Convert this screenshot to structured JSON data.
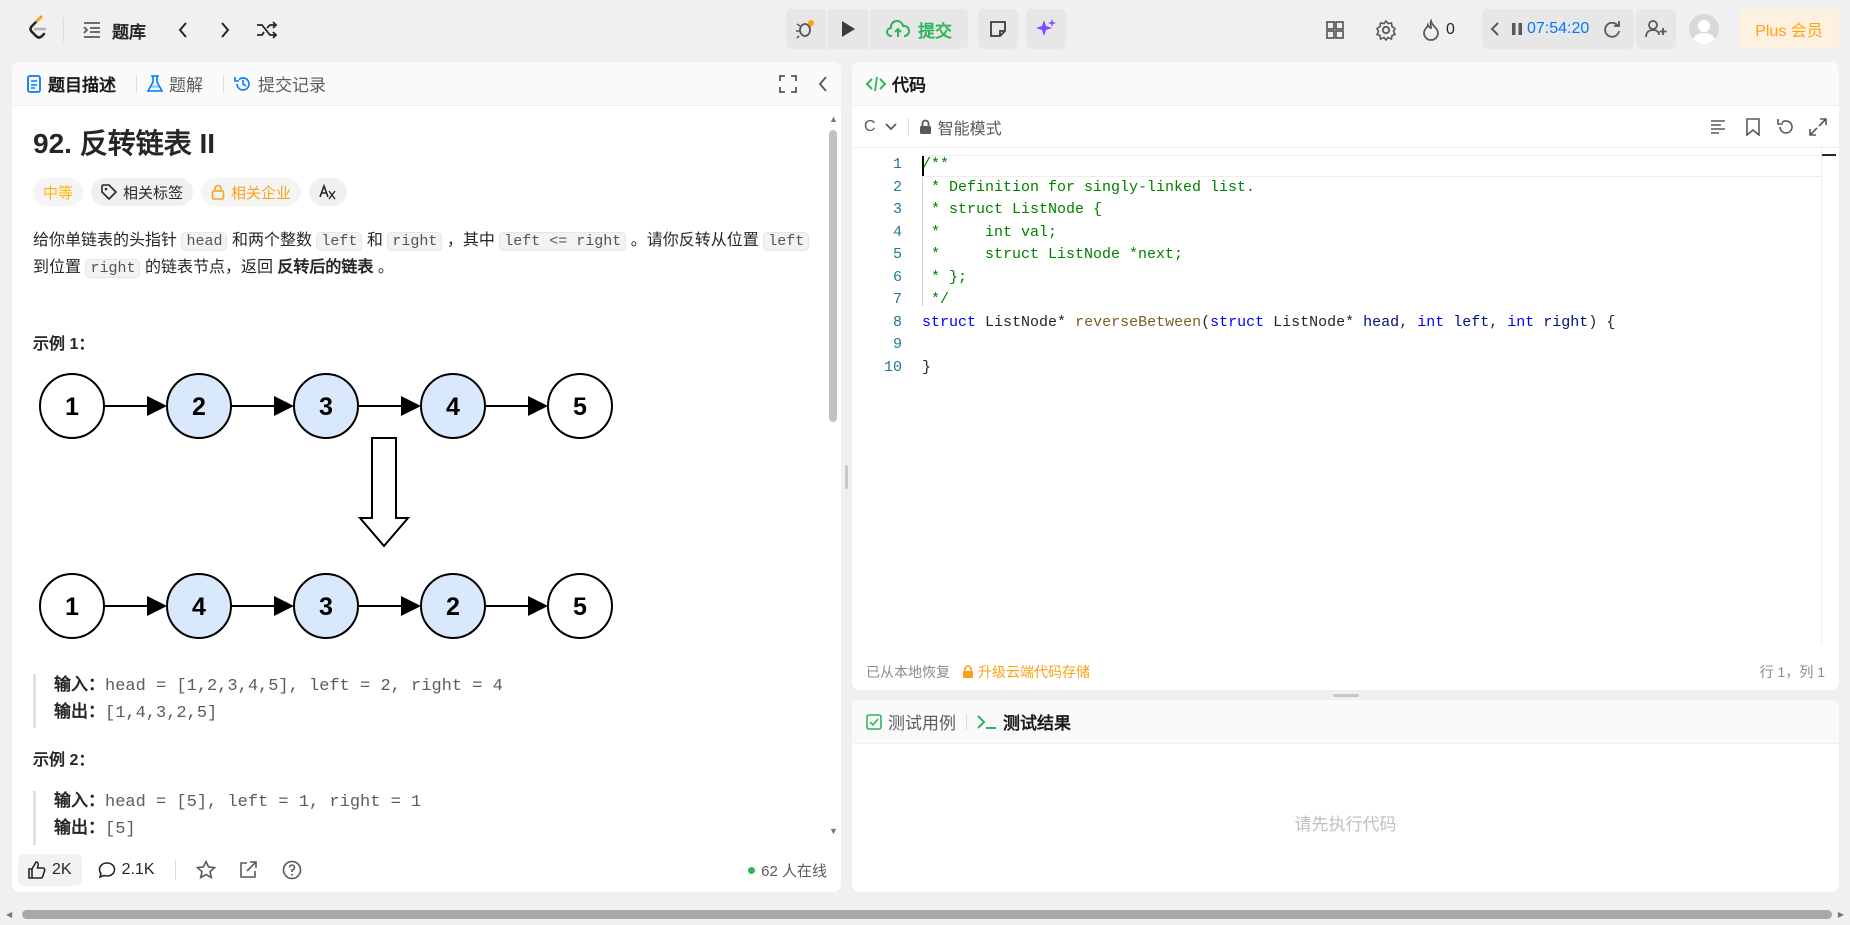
{
  "topbar": {
    "problem_list_label": "题库",
    "submit_label": "提交",
    "streak_count": "0",
    "timer": "07:54:20",
    "plus_label": "Plus 会员"
  },
  "left": {
    "tabs": [
      {
        "label": "题目描述"
      },
      {
        "label": "题解"
      },
      {
        "label": "提交记录"
      }
    ],
    "title": "92. 反转链表 II",
    "difficulty": "中等",
    "tag_related": "相关标签",
    "tag_company": "相关企业",
    "desc": {
      "p1": "给你单链表的头指针",
      "c1": "head",
      "p2": "和两个整数",
      "c2": "left",
      "p3": "和",
      "c3": "right",
      "p4": "，其中",
      "c4": "left <= right",
      "p5": "。请你反转从位置",
      "c5": "left",
      "p6": "到位置",
      "c6": "right",
      "p7": "的链表节点，返回",
      "b1": "反转后的链表",
      "p8": "。"
    },
    "example1": {
      "heading": "示例 1：",
      "input_label": "输入：",
      "input": "head = [1,2,3,4,5], left = 2, right = 4",
      "output_label": "输出：",
      "output": "[1,4,3,2,5]"
    },
    "diagram": {
      "top": [
        "1",
        "2",
        "3",
        "4",
        "5"
      ],
      "bottom": [
        "1",
        "4",
        "3",
        "2",
        "5"
      ]
    },
    "example2": {
      "heading": "示例 2：",
      "input_label": "输入：",
      "input": "head = [5], left = 1, right = 1",
      "output_label": "输出：",
      "output": "[5]"
    },
    "footer": {
      "likes": "2K",
      "comments": "2.1K",
      "online": "62 人在线"
    }
  },
  "code": {
    "tab_label": "代码",
    "language": "C",
    "mode": "智能模式",
    "line_numbers": [
      "1",
      "2",
      "3",
      "4",
      "5",
      "6",
      "7",
      "8",
      "9",
      "10"
    ],
    "status_restore": "已从本地恢复",
    "status_upgrade": "升级云端代码存储",
    "cursor_pos": "行 1，列 1"
  },
  "tests": {
    "tab_cases": "测试用例",
    "tab_result": "测试结果",
    "placeholder": "请先执行代码"
  },
  "colors": {
    "accent_green": "#2db55d",
    "accent_blue": "#007aff",
    "node_fill": "#dae8fc",
    "plus_bg": "#fff1e0",
    "plus_text": "#ffa116"
  }
}
